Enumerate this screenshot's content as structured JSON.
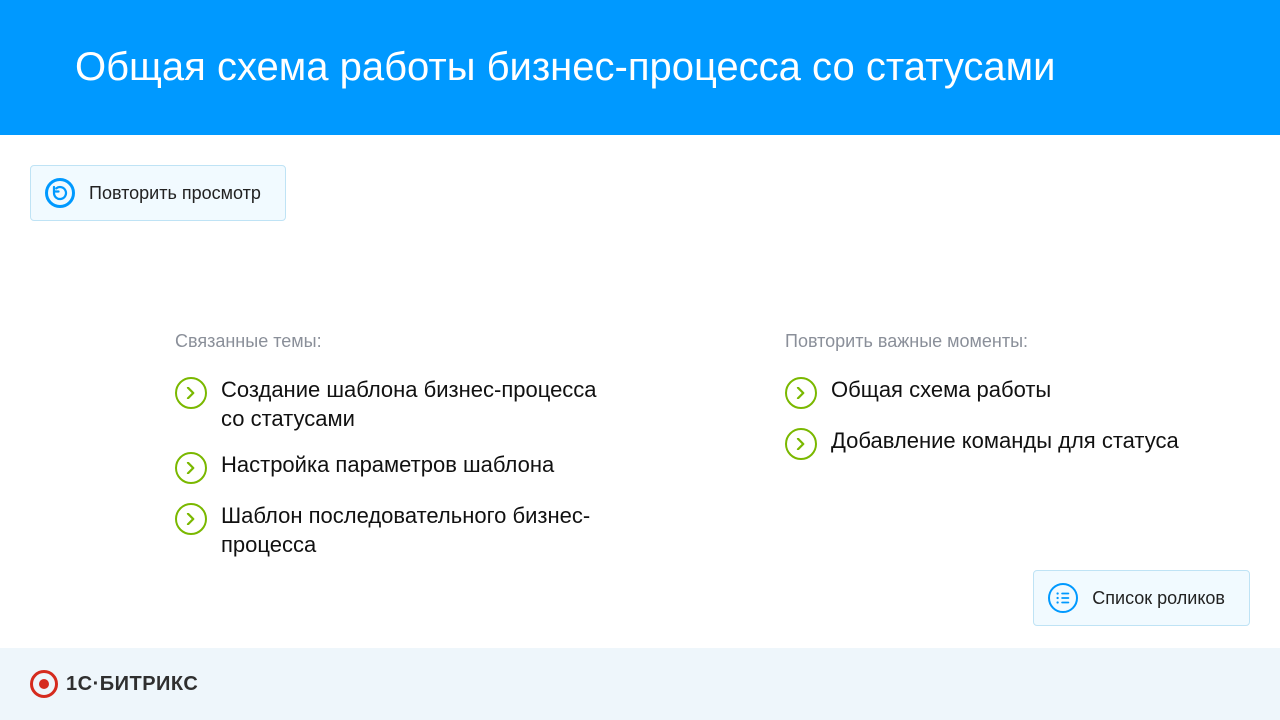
{
  "header": {
    "title": "Общая схема работы бизнес-процесса со статусами"
  },
  "replay": {
    "label": "Повторить просмотр"
  },
  "left": {
    "heading": "Связанные темы:",
    "items": [
      "Создание шаблона бизнес-процесса со статусами",
      "Настройка параметров шаблона",
      "Шаблон последовательного бизнес-процесса"
    ]
  },
  "right": {
    "heading": "Повторить важные моменты:",
    "items": [
      "Общая схема работы",
      "Добавление команды для статуса"
    ]
  },
  "video_list": {
    "label": "Список роликов"
  },
  "footer": {
    "brand": "1С·БИТРИКС"
  },
  "colors": {
    "accent": "#0099ff",
    "chevron": "#7ab800",
    "panel": "#f1faff",
    "panel_border": "#bfe3f5"
  }
}
